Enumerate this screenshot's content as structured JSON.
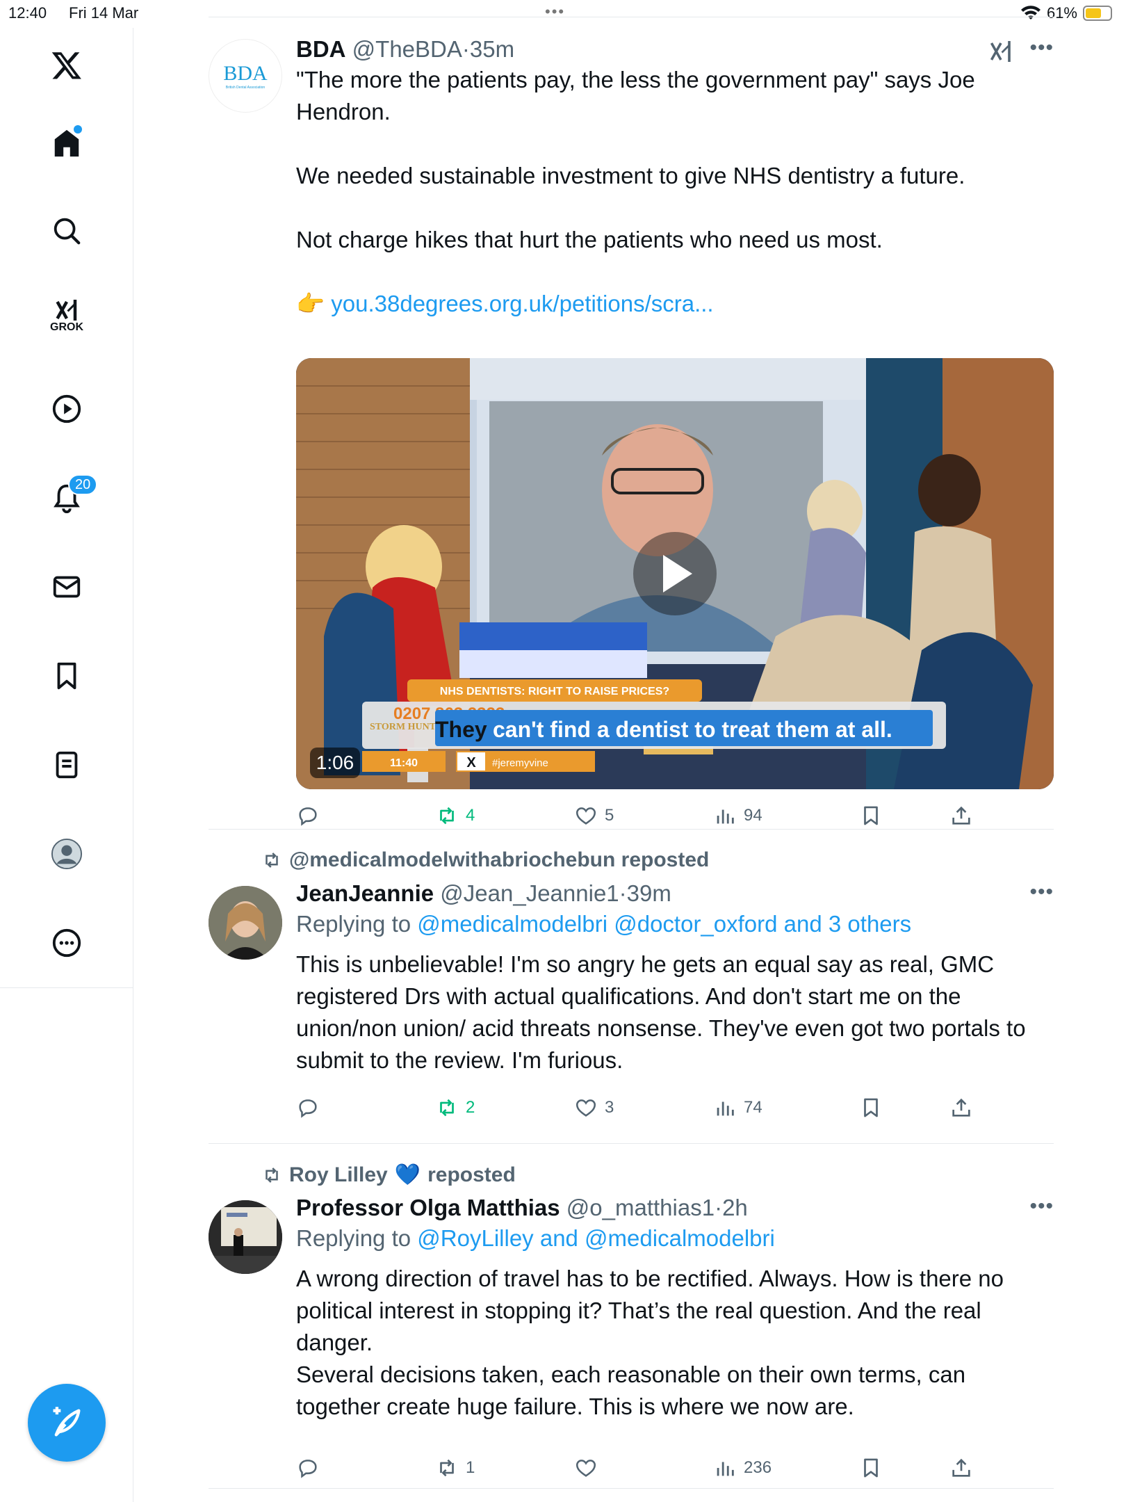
{
  "status_bar": {
    "time": "12:40",
    "date": "Fri 14 Mar",
    "dots": "•••",
    "battery": "61%"
  },
  "sidebar": {
    "notifications_badge": "20",
    "grok_label": "GROK"
  },
  "tweets": [
    {
      "name": "BDA",
      "handle": "@TheBDA",
      "time": "35m",
      "avatar_text": "BDA",
      "avatar_subtext": "British Dental Association",
      "body": [
        "\"The more the patients pay, the less the government pay\" says Joe Hendron.",
        "We needed sustainable investment to give NHS dentistry a future.",
        "Not charge hikes that hurt the patients who need us most."
      ],
      "link_emoji": "👉",
      "link": "you.38degrees.org.uk/petitions/scra...",
      "video": {
        "duration": "1:06",
        "banner": "NHS DENTISTS: RIGHT TO RAISE PRICES?",
        "subtitle_word": "They",
        "subtitle_rest": "can't find a dentist to treat them at all.",
        "phone": "0207 863 2323",
        "show": "STORM HUNTER",
        "clock": "11:40",
        "hashtag": "#jeremyvine"
      },
      "stats": {
        "reposts": "4",
        "likes": "5",
        "views": "94"
      }
    },
    {
      "repost_by": "@medicalmodelwithabriochebun reposted",
      "name": "JeanJeannie",
      "handle": "@Jean_Jeannie1",
      "time": "39m",
      "replying_prefix": "Replying to",
      "replying_to": "@medicalmodelbri @doctor_oxford and 3 others",
      "body": "This is unbelievable! I'm so angry he gets an equal say as real, GMC registered Drs with actual qualifications. And don't start me on the union/non union/ acid threats nonsense.  They've even got two portals to submit to the review. I'm furious.",
      "stats": {
        "reposts": "2",
        "likes": "3",
        "views": "74"
      }
    },
    {
      "repost_name": "Roy Lilley",
      "repost_emoji": "💙",
      "repost_suffix": "reposted",
      "name": "Professor Olga Matthias",
      "handle": "@o_matthias1",
      "time": "2h",
      "replying_prefix": "Replying to",
      "replying_to": "@RoyLilley and @medicalmodelbri",
      "body": [
        "A wrong direction of travel has to be rectified. Always. How is there no political interest in stopping it? That’s the real question. And the real danger.",
        "Several decisions taken, each reasonable on their own terms, can together create huge failure. This is where we now are."
      ],
      "stats": {
        "reposts": "1",
        "likes": "",
        "views": "236"
      }
    }
  ],
  "colors": {
    "accent": "#1d9bf0",
    "repost_green": "#00ba7c",
    "muted": "#536471"
  }
}
